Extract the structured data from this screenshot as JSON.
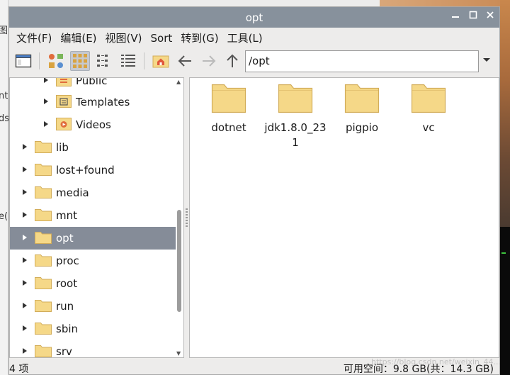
{
  "window": {
    "title": "opt"
  },
  "background": {
    "left_fragments": [
      "图",
      "nts",
      "ds",
      "e("
    ]
  },
  "menubar": {
    "items": [
      "文件(F)",
      "编辑(E)",
      "视图(V)",
      "Sort",
      "转到(G)",
      "工具(L)"
    ]
  },
  "toolbar": {
    "address": "/opt",
    "icons": [
      "new-window-icon",
      "thumbnail-view-icon",
      "icon-view-icon",
      "compact-view-icon",
      "detailed-list-view-icon",
      "home-icon",
      "back-arrow-icon",
      "forward-arrow-icon",
      "up-arrow-icon"
    ]
  },
  "sidebar": {
    "items": [
      {
        "label": "Public"
      },
      {
        "label": "Templates"
      },
      {
        "label": "Videos"
      },
      {
        "label": "lib"
      },
      {
        "label": "lost+found"
      },
      {
        "label": "media"
      },
      {
        "label": "mnt"
      },
      {
        "label": "opt",
        "selected": true
      },
      {
        "label": "proc"
      },
      {
        "label": "root"
      },
      {
        "label": "run"
      },
      {
        "label": "sbin"
      },
      {
        "label": "srv"
      }
    ]
  },
  "files": [
    {
      "name": "dotnet"
    },
    {
      "name": "jdk1.8.0_231"
    },
    {
      "name": "pigpio"
    },
    {
      "name": "vc"
    }
  ],
  "status": {
    "count": "4 项",
    "free_space": "可用空间：9.8 GB(共：14.3 GB)"
  },
  "watermark": "https://blog.csdn.net/weixin_44...",
  "colors": {
    "titlebar": "#87919c",
    "selection": "#858c98",
    "folder_fill": "#f5d888",
    "folder_stroke": "#d2ad5a"
  }
}
